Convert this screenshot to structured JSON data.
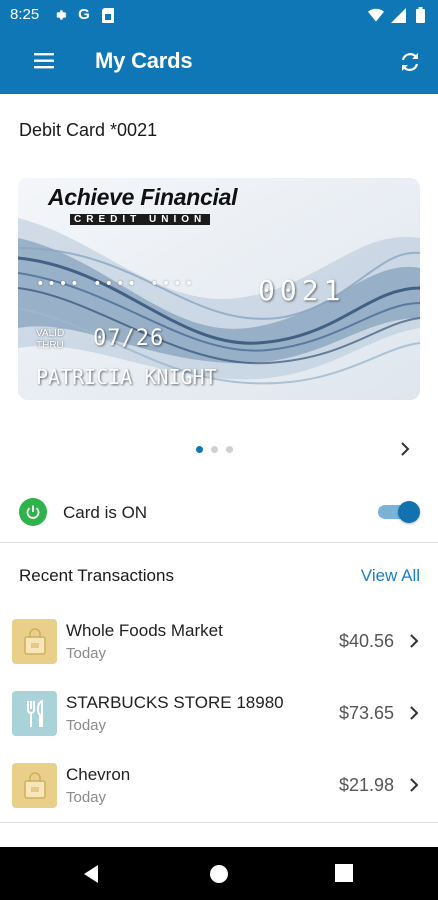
{
  "status_bar": {
    "time": "8:25",
    "left_icons": [
      "gear-icon",
      "google-icon",
      "sim-card-icon"
    ],
    "right_icons": [
      "wifi-icon",
      "signal-icon",
      "battery-icon"
    ],
    "google_letter": "G"
  },
  "app_bar": {
    "title": "My Cards",
    "background": "#0f77b6"
  },
  "card": {
    "title": "Debit Card *0021",
    "issuer_name": "Achieve Financial",
    "issuer_sub": "CREDIT UNION",
    "masked_number": "•••• •••• ••••",
    "last_digits": "0021",
    "valid_label_1": "VALID",
    "valid_label_2": "THRU",
    "expiry": "07/26",
    "holder": "PATRICIA KNIGHT",
    "pager_count": 3,
    "pager_active": 0
  },
  "card_status": {
    "label": "Card is ON",
    "on": true,
    "accent": "#2db34a"
  },
  "transactions": {
    "header": "Recent Transactions",
    "view_all": "View All",
    "items": [
      {
        "name": "Whole Foods Market",
        "date": "Today",
        "amount": "$40.56",
        "icon": "shopping-bag-icon",
        "icon_color": "#e9cf8a"
      },
      {
        "name": "STARBUCKS STORE 18980",
        "date": "Today",
        "amount": "$73.65",
        "icon": "fork-knife-icon",
        "icon_color": "#a9d3d8"
      },
      {
        "name": "Chevron",
        "date": "Today",
        "amount": "$21.98",
        "icon": "shopping-bag-icon",
        "icon_color": "#e9cf8a"
      }
    ]
  },
  "nav_bar": {
    "buttons": [
      "back-icon",
      "home-icon",
      "recents-icon"
    ]
  }
}
